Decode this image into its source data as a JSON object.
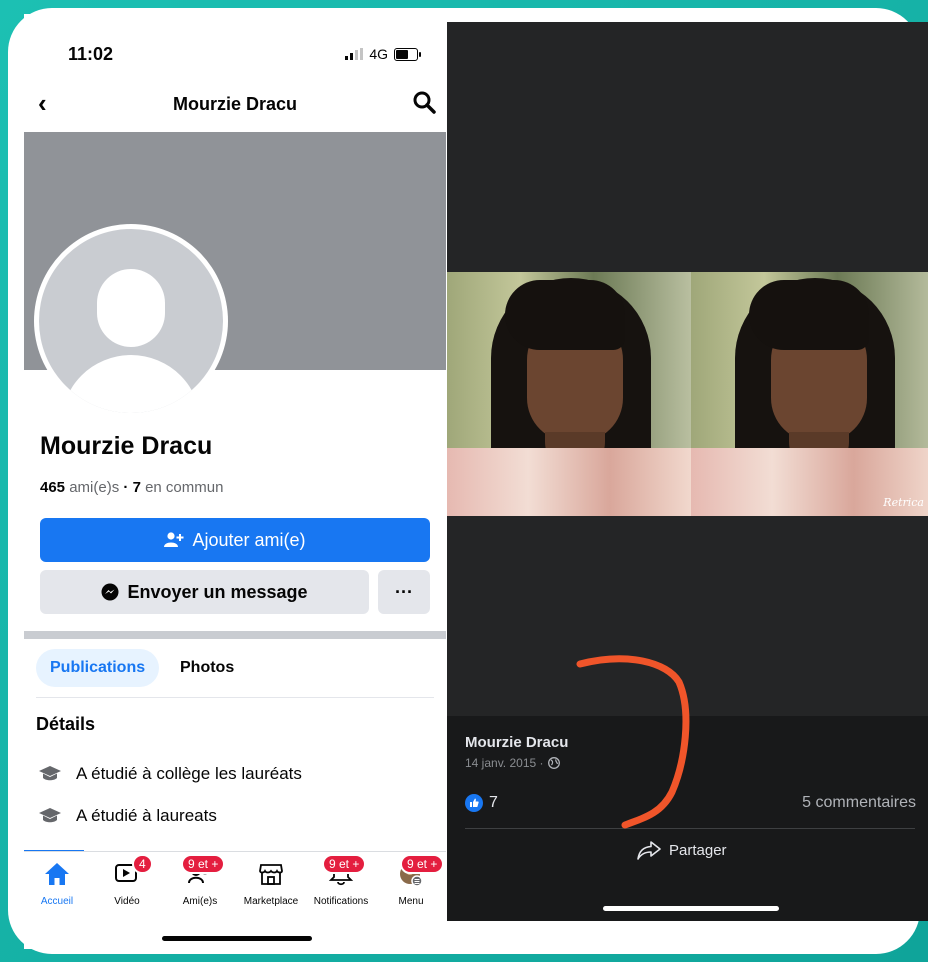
{
  "left": {
    "status": {
      "time": "11:02",
      "network": "4G"
    },
    "nav": {
      "back": "‹",
      "title": "Mourzie Dracu"
    },
    "profile": {
      "name": "Mourzie Dracu",
      "friends_count": "465",
      "friends_label": "ami(e)s",
      "separator": "·",
      "mutual_count": "7",
      "mutual_label": "en commun"
    },
    "actions": {
      "add_friend": "Ajouter ami(e)",
      "message": "Envoyer un message",
      "more": "···"
    },
    "tabs": [
      "Publications",
      "Photos"
    ],
    "details": {
      "title": "Détails",
      "items": [
        "A étudié à collège les lauréats",
        "A étudié à laureats"
      ]
    },
    "tabbar": {
      "items": [
        {
          "label": "Accueil",
          "icon": "home-icon"
        },
        {
          "label": "Vidéo",
          "icon": "video-icon",
          "badge": "4"
        },
        {
          "label": "Ami(e)s",
          "icon": "friends-icon",
          "badge": "9 et +"
        },
        {
          "label": "Marketplace",
          "icon": "marketplace-icon"
        },
        {
          "label": "Notifications",
          "icon": "bell-icon",
          "badge": "9 et +"
        },
        {
          "label": "Menu",
          "icon": "menu-avatar-icon",
          "badge": "9 et +"
        }
      ]
    }
  },
  "right": {
    "photo_watermark": "Retrica",
    "post": {
      "author": "Mourzie Dracu",
      "date": "14 janv. 2015 ·",
      "likes": "7",
      "comments": "5 commentaires",
      "share": "Partager"
    }
  },
  "colors": {
    "frame": "#19b3a8",
    "fb_blue": "#1877f2",
    "badge_red": "#e41e3f",
    "annotation": "#f0552a"
  }
}
